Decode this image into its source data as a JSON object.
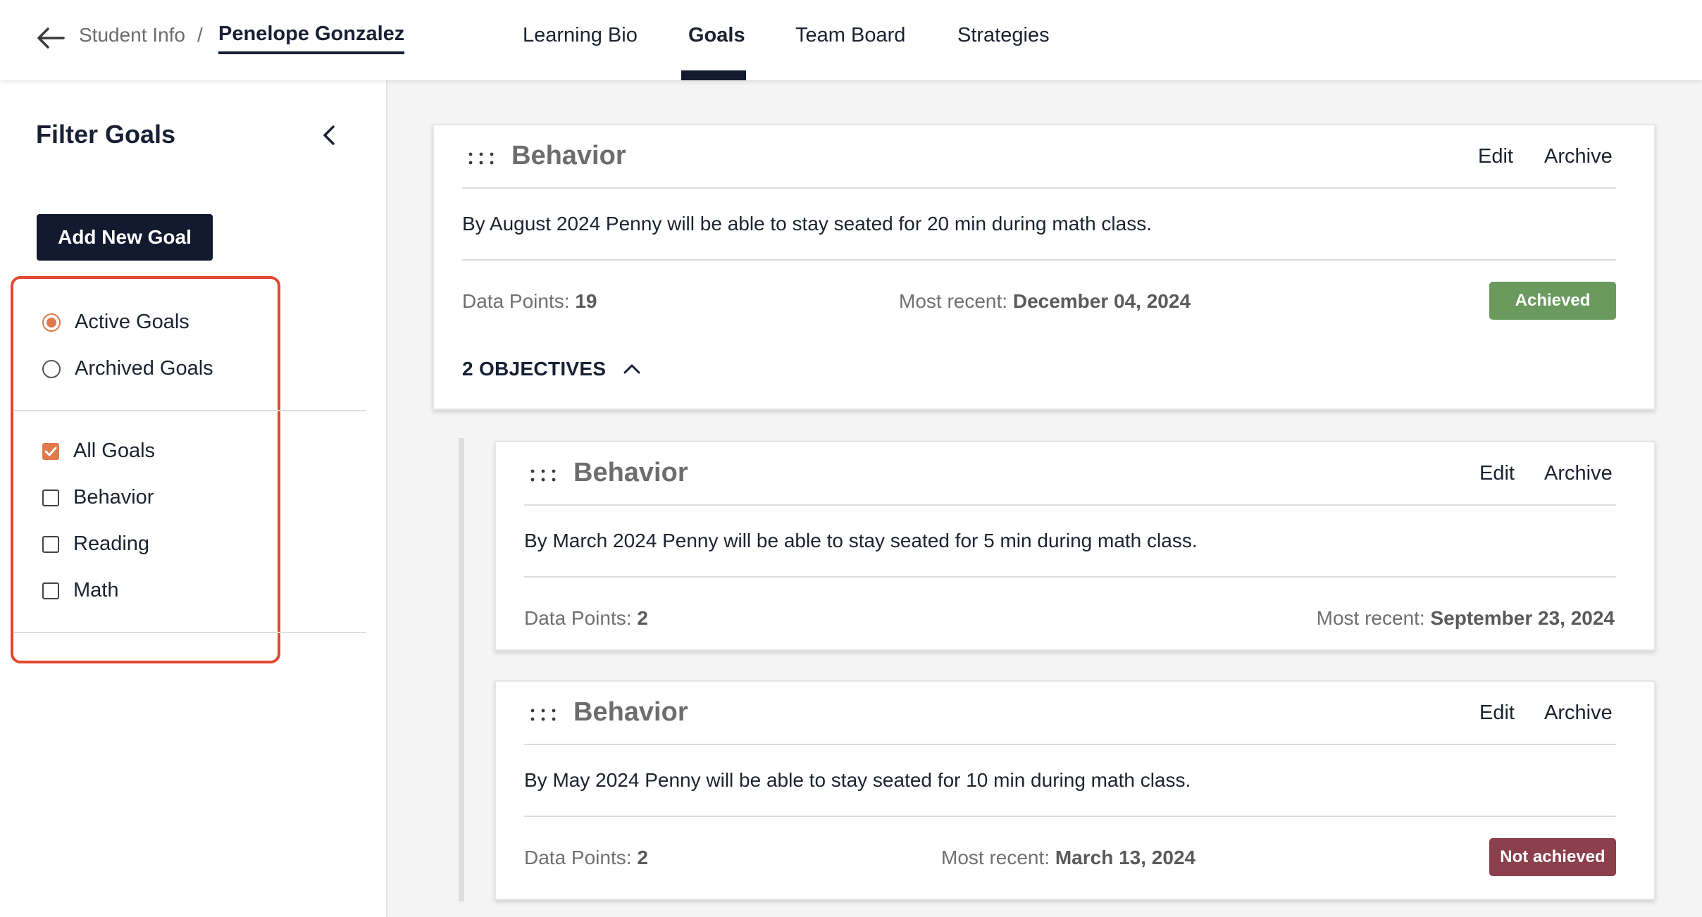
{
  "breadcrumb": {
    "parent": "Student Info",
    "separator": "/",
    "current": "Penelope Gonzalez"
  },
  "tabs": [
    {
      "label": "Learning Bio"
    },
    {
      "label": "Goals",
      "active": true
    },
    {
      "label": "Team Board"
    },
    {
      "label": "Strategies"
    }
  ],
  "sidebar": {
    "title": "Filter Goals",
    "add_button": "Add New Goal",
    "status_options": [
      {
        "label": "Active Goals",
        "checked": true
      },
      {
        "label": "Archived Goals",
        "checked": false
      }
    ],
    "category_options": [
      {
        "label": "All Goals",
        "checked": true
      },
      {
        "label": "Behavior",
        "checked": false
      },
      {
        "label": "Reading",
        "checked": false
      },
      {
        "label": "Math",
        "checked": false
      }
    ]
  },
  "goal": {
    "title": "Behavior",
    "edit_label": "Edit",
    "archive_label": "Archive",
    "description": "By August 2024 Penny will be able to stay seated for 20 min during math class.",
    "data_points_label": "Data Points:",
    "data_points": "19",
    "recent_label": "Most recent:",
    "recent_date": "December 04, 2024",
    "status": "Achieved",
    "objectives_label": "2 OBJECTIVES"
  },
  "objectives": [
    {
      "title": "Behavior",
      "edit_label": "Edit",
      "archive_label": "Archive",
      "description": "By March 2024 Penny will be able to stay seated for 5 min during math class.",
      "data_points_label": "Data Points:",
      "data_points": "2",
      "recent_label": "Most recent:",
      "recent_date": "September 23, 2024"
    },
    {
      "title": "Behavior",
      "edit_label": "Edit",
      "archive_label": "Archive",
      "description": "By May 2024 Penny will be able to stay seated for 10 min during math class.",
      "data_points_label": "Data Points:",
      "data_points": "2",
      "recent_label": "Most recent:",
      "recent_date": "March 13, 2024",
      "status": "Not achieved"
    }
  ],
  "colors": {
    "navy": "#111a2e",
    "accent_orange": "#e07a4a",
    "highlight_red": "#e4472f",
    "achieved_green": "#6a9a5e",
    "not_achieved_maroon": "#8c3f4d"
  }
}
